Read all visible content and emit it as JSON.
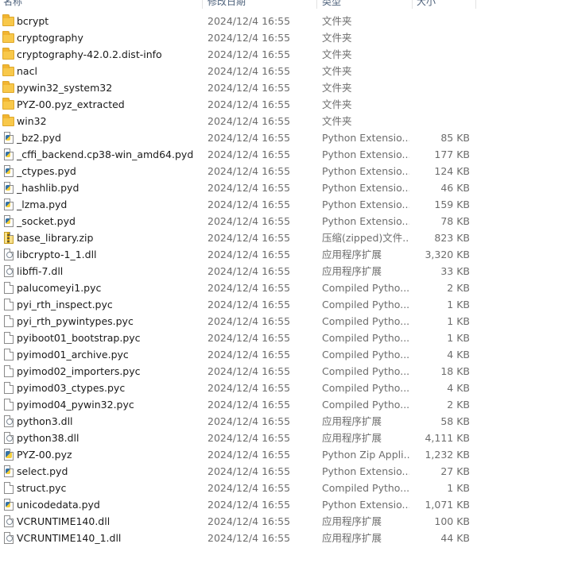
{
  "header": {
    "columns": [
      {
        "label": "名称"
      },
      {
        "label": "修改日期"
      },
      {
        "label": "类型"
      },
      {
        "label": "大小"
      }
    ]
  },
  "files": [
    {
      "name": "bcrypt",
      "date": "2024/12/4 16:55",
      "type": "文件夹",
      "size": "",
      "icon": "folder-icon"
    },
    {
      "name": "cryptography",
      "date": "2024/12/4 16:55",
      "type": "文件夹",
      "size": "",
      "icon": "folder-icon"
    },
    {
      "name": "cryptography-42.0.2.dist-info",
      "date": "2024/12/4 16:55",
      "type": "文件夹",
      "size": "",
      "icon": "folder-icon"
    },
    {
      "name": "nacl",
      "date": "2024/12/4 16:55",
      "type": "文件夹",
      "size": "",
      "icon": "folder-icon"
    },
    {
      "name": "pywin32_system32",
      "date": "2024/12/4 16:55",
      "type": "文件夹",
      "size": "",
      "icon": "folder-icon"
    },
    {
      "name": "PYZ-00.pyz_extracted",
      "date": "2024/12/4 16:55",
      "type": "文件夹",
      "size": "",
      "icon": "folder-icon"
    },
    {
      "name": "win32",
      "date": "2024/12/4 16:55",
      "type": "文件夹",
      "size": "",
      "icon": "folder-icon"
    },
    {
      "name": "_bz2.pyd",
      "date": "2024/12/4 16:55",
      "type": "Python Extensio...",
      "size": "85 KB",
      "icon": "python-file-icon"
    },
    {
      "name": "_cffi_backend.cp38-win_amd64.pyd",
      "date": "2024/12/4 16:55",
      "type": "Python Extensio...",
      "size": "177 KB",
      "icon": "python-file-icon"
    },
    {
      "name": "_ctypes.pyd",
      "date": "2024/12/4 16:55",
      "type": "Python Extensio...",
      "size": "124 KB",
      "icon": "python-file-icon"
    },
    {
      "name": "_hashlib.pyd",
      "date": "2024/12/4 16:55",
      "type": "Python Extensio...",
      "size": "46 KB",
      "icon": "python-file-icon"
    },
    {
      "name": "_lzma.pyd",
      "date": "2024/12/4 16:55",
      "type": "Python Extensio...",
      "size": "159 KB",
      "icon": "python-file-icon"
    },
    {
      "name": "_socket.pyd",
      "date": "2024/12/4 16:55",
      "type": "Python Extensio...",
      "size": "78 KB",
      "icon": "python-file-icon"
    },
    {
      "name": "base_library.zip",
      "date": "2024/12/4 16:55",
      "type": "压缩(zipped)文件...",
      "size": "823 KB",
      "icon": "zip-file-icon"
    },
    {
      "name": "libcrypto-1_1.dll",
      "date": "2024/12/4 16:55",
      "type": "应用程序扩展",
      "size": "3,320 KB",
      "icon": "dll-file-icon"
    },
    {
      "name": "libffi-7.dll",
      "date": "2024/12/4 16:55",
      "type": "应用程序扩展",
      "size": "33 KB",
      "icon": "dll-file-icon"
    },
    {
      "name": "palucomeyi1.pyc",
      "date": "2024/12/4 16:55",
      "type": "Compiled Pytho...",
      "size": "2 KB",
      "icon": "file-icon"
    },
    {
      "name": "pyi_rth_inspect.pyc",
      "date": "2024/12/4 16:55",
      "type": "Compiled Pytho...",
      "size": "1 KB",
      "icon": "file-icon"
    },
    {
      "name": "pyi_rth_pywintypes.pyc",
      "date": "2024/12/4 16:55",
      "type": "Compiled Pytho...",
      "size": "1 KB",
      "icon": "file-icon"
    },
    {
      "name": "pyiboot01_bootstrap.pyc",
      "date": "2024/12/4 16:55",
      "type": "Compiled Pytho...",
      "size": "1 KB",
      "icon": "file-icon"
    },
    {
      "name": "pyimod01_archive.pyc",
      "date": "2024/12/4 16:55",
      "type": "Compiled Pytho...",
      "size": "4 KB",
      "icon": "file-icon"
    },
    {
      "name": "pyimod02_importers.pyc",
      "date": "2024/12/4 16:55",
      "type": "Compiled Pytho...",
      "size": "18 KB",
      "icon": "file-icon"
    },
    {
      "name": "pyimod03_ctypes.pyc",
      "date": "2024/12/4 16:55",
      "type": "Compiled Pytho...",
      "size": "4 KB",
      "icon": "file-icon"
    },
    {
      "name": "pyimod04_pywin32.pyc",
      "date": "2024/12/4 16:55",
      "type": "Compiled Pytho...",
      "size": "2 KB",
      "icon": "file-icon"
    },
    {
      "name": "python3.dll",
      "date": "2024/12/4 16:55",
      "type": "应用程序扩展",
      "size": "58 KB",
      "icon": "dll-file-icon"
    },
    {
      "name": "python38.dll",
      "date": "2024/12/4 16:55",
      "type": "应用程序扩展",
      "size": "4,111 KB",
      "icon": "dll-file-icon"
    },
    {
      "name": "PYZ-00.pyz",
      "date": "2024/12/4 16:55",
      "type": "Python Zip Appli...",
      "size": "1,232 KB",
      "icon": "pyz-file-icon"
    },
    {
      "name": "select.pyd",
      "date": "2024/12/4 16:55",
      "type": "Python Extensio...",
      "size": "27 KB",
      "icon": "python-file-icon"
    },
    {
      "name": "struct.pyc",
      "date": "2024/12/4 16:55",
      "type": "Compiled Pytho...",
      "size": "1 KB",
      "icon": "file-icon"
    },
    {
      "name": "unicodedata.pyd",
      "date": "2024/12/4 16:55",
      "type": "Python Extensio...",
      "size": "1,071 KB",
      "icon": "python-file-icon"
    },
    {
      "name": "VCRUNTIME140.dll",
      "date": "2024/12/4 16:55",
      "type": "应用程序扩展",
      "size": "100 KB",
      "icon": "dll-file-icon"
    },
    {
      "name": "VCRUNTIME140_1.dll",
      "date": "2024/12/4 16:55",
      "type": "应用程序扩展",
      "size": "44 KB",
      "icon": "dll-file-icon"
    }
  ]
}
